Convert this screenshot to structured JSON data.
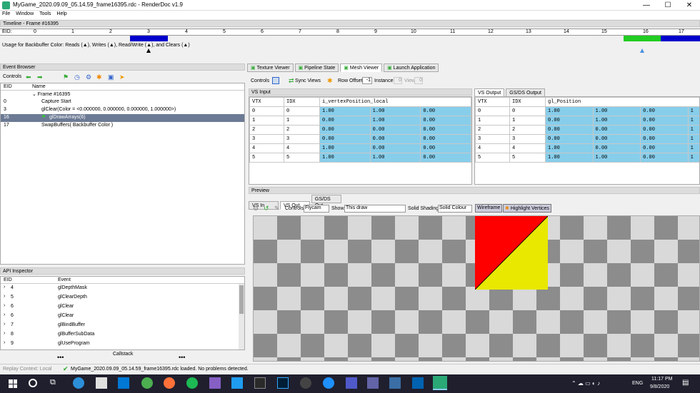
{
  "window": {
    "title": "MyGame_2020.09.09_05.14.59_frame16395.rdc - RenderDoc v1.9",
    "minimize": "—",
    "maximize": "☐",
    "close": "✕"
  },
  "menu": [
    "File",
    "Window",
    "Tools",
    "Help"
  ],
  "timeline": {
    "header": "Timeline - Frame #16395",
    "eid_label": "EID:",
    "ticks": [
      "0",
      "1",
      "2",
      "3",
      "4",
      "5",
      "6",
      "7",
      "8",
      "9",
      "10",
      "11",
      "12",
      "13",
      "14",
      "15",
      "16",
      "17"
    ],
    "usage_text": "Usage for Backbuffer Color: Reads (▲), Writes (▲), Read/Write (▲), and Clears (▲)"
  },
  "event_browser": {
    "header": "Event Browser",
    "controls_label": "Controls",
    "columns": [
      "EID",
      "Name"
    ],
    "rows": [
      {
        "eid": "",
        "name": "⌄ Frame #16395"
      },
      {
        "eid": "0",
        "name": "Capture Start"
      },
      {
        "eid": "3",
        "name": "glClear(Color = <0.000000, 0.000000, 0.000000, 1.000000>)"
      },
      {
        "eid": "16",
        "name": "glDrawArrays(6)"
      },
      {
        "eid": "17",
        "name": "SwapBuffers( Backbuffer Color )"
      }
    ]
  },
  "api_inspector": {
    "header": "API Inspector",
    "columns": [
      "EID",
      "Event"
    ],
    "rows": [
      {
        "eid": "4",
        "event": "glDepthMask"
      },
      {
        "eid": "5",
        "event": "glClearDepth"
      },
      {
        "eid": "6",
        "event": "glClear"
      },
      {
        "eid": "6",
        "event": "glClear"
      },
      {
        "eid": "7",
        "event": "glBindBuffer"
      },
      {
        "eid": "8",
        "event": "glBufferSubData"
      },
      {
        "eid": "9",
        "event": "glUseProgram"
      }
    ],
    "callstack": "Callstack",
    "dots": "•••"
  },
  "tabs": [
    "Texture Viewer",
    "Pipeline State",
    "Mesh Viewer",
    "Launch Application"
  ],
  "mesh_toolbar": {
    "controls": "Controls",
    "sync_views": "Sync Views",
    "row_offset": "Row Offset",
    "row_offset_value": "-1",
    "instance": "Instance",
    "instance_value": "0",
    "view": "View",
    "view_value": "0"
  },
  "vs_input": {
    "header": "VS Input",
    "columns": [
      "VTX",
      "IDX",
      "i_vertexPosition_local"
    ],
    "rows": [
      [
        "0",
        "0",
        "1.00",
        "1.00",
        "0.00"
      ],
      [
        "1",
        "1",
        "0.00",
        "1.00",
        "0.00"
      ],
      [
        "2",
        "2",
        "0.00",
        "0.00",
        "0.00"
      ],
      [
        "3",
        "3",
        "0.00",
        "0.00",
        "0.00"
      ],
      [
        "4",
        "4",
        "1.00",
        "0.00",
        "0.00"
      ],
      [
        "5",
        "5",
        "1.00",
        "1.00",
        "0.00"
      ]
    ]
  },
  "vs_output": {
    "tabs": [
      "VS Output",
      "GS/DS Output"
    ],
    "columns": [
      "VTX",
      "IDX",
      "gl_Position"
    ],
    "rows": [
      [
        "0",
        "0",
        "1.00",
        "1.00",
        "0.00",
        "1"
      ],
      [
        "1",
        "1",
        "0.00",
        "1.00",
        "0.00",
        "1"
      ],
      [
        "2",
        "2",
        "0.00",
        "0.00",
        "0.00",
        "1"
      ],
      [
        "3",
        "3",
        "0.00",
        "0.00",
        "0.00",
        "1"
      ],
      [
        "4",
        "4",
        "1.00",
        "0.00",
        "0.00",
        "1"
      ],
      [
        "5",
        "5",
        "1.00",
        "1.00",
        "0.00",
        "1"
      ]
    ]
  },
  "preview": {
    "header": "Preview",
    "tabs": [
      "VS In",
      "VS Out",
      "GS/DS Out"
    ],
    "controls": "Controls",
    "cam": "Flycam",
    "show": "Show",
    "show_value": "This draw",
    "solid_shading": "Solid Shading",
    "solid_value": "Solid Colour",
    "wireframe": "Wireframe",
    "highlight": "Highlight Vertices"
  },
  "status": {
    "context": "Replay Context: Local",
    "message": "MyGame_2020.09.09_05.14.59_frame16395.rdc loaded. No problems detected."
  },
  "taskbar": {
    "time": "11:17 PM",
    "date": "9/8/2020",
    "lang": "ENG"
  },
  "colors": {
    "red": "#ff0000",
    "yellow": "#e8e800",
    "blue_cell": "#87ceeb",
    "accent": "#0000cc"
  }
}
